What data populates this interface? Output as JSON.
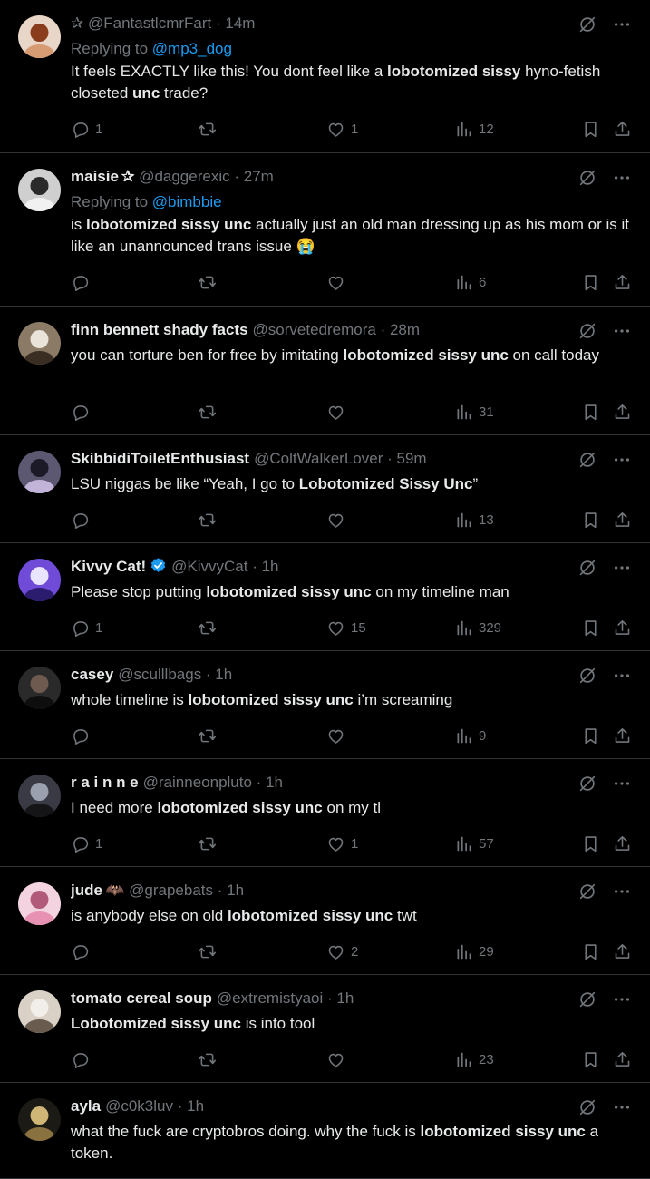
{
  "tweets": [
    {
      "prefix": "✰ ",
      "name": "",
      "handle": "@FantastlcmrFart",
      "time": "14m",
      "reply_to": "@mp3_dog",
      "body": [
        [
          "It feels EXACTLY like this! You dont feel like a ",
          ""
        ],
        [
          "lobotomized sissy",
          "b"
        ],
        [
          " hyno-fetish closeted ",
          ""
        ],
        [
          "unc",
          "b"
        ],
        [
          " trade?",
          ""
        ]
      ],
      "replies": "1",
      "retweets": "",
      "likes": "1",
      "views": "12"
    },
    {
      "prefix": "",
      "name": "maisie",
      "name_suffix": "✰",
      "handle": "@daggerexic",
      "time": "27m",
      "reply_to": "@bimbbie",
      "body": [
        [
          "is ",
          ""
        ],
        [
          "lobotomized sissy unc",
          "b"
        ],
        [
          " actually just an old man dressing up as his mom or is it like an unannounced trans issue ",
          ""
        ],
        [
          "😭",
          ""
        ]
      ],
      "replies": "",
      "retweets": "",
      "likes": "",
      "views": "6"
    },
    {
      "prefix": "",
      "name": "finn bennett shady facts",
      "handle": "@sorvetedremora",
      "time": "28m",
      "reply_to": "",
      "body": [
        [
          "you can torture ben for free by imitating ",
          ""
        ],
        [
          "lobotomized sissy unc",
          "b"
        ],
        [
          " on call today",
          ""
        ]
      ],
      "replies": "",
      "retweets": "",
      "likes": "",
      "views": "31"
    },
    {
      "prefix": "",
      "name": "SkibbidiToiletEnthusiast",
      "handle": "@ColtWalkerLover",
      "time": "59m",
      "reply_to": "",
      "body": [
        [
          "LSU niggas be like “Yeah, I go to ",
          ""
        ],
        [
          "Lobotomized Sissy Unc",
          "b"
        ],
        [
          "”",
          ""
        ]
      ],
      "replies": "",
      "retweets": "",
      "likes": "",
      "views": "13"
    },
    {
      "prefix": "",
      "name": "Kivvy Cat!",
      "verified": true,
      "handle": "@KivvyCat",
      "time": "1h",
      "reply_to": "",
      "body": [
        [
          "Please stop putting ",
          ""
        ],
        [
          "lobotomized sissy unc",
          "b"
        ],
        [
          " on my timeline man",
          ""
        ]
      ],
      "replies": "1",
      "retweets": "",
      "likes": "15",
      "views": "329"
    },
    {
      "prefix": "",
      "name": "casey",
      "handle": "@sculllbags",
      "time": "1h",
      "reply_to": "",
      "body": [
        [
          "whole timeline is ",
          ""
        ],
        [
          "lobotomized sissy unc",
          "b"
        ],
        [
          " i’m screaming",
          ""
        ]
      ],
      "replies": "",
      "retweets": "",
      "likes": "",
      "views": "9"
    },
    {
      "prefix": "",
      "name": "r a i n n e",
      "handle": "@rainneonpluto",
      "time": "1h",
      "reply_to": "",
      "body": [
        [
          "I need more ",
          ""
        ],
        [
          "lobotomized sissy unc",
          "b"
        ],
        [
          " on my tl",
          ""
        ]
      ],
      "replies": "1",
      "retweets": "",
      "likes": "1",
      "views": "57"
    },
    {
      "prefix": "",
      "name": "jude",
      "name_suffix": "🦇",
      "handle": "@grapebats",
      "time": "1h",
      "reply_to": "",
      "body": [
        [
          "is anybody else on old ",
          ""
        ],
        [
          "lobotomized sissy unc",
          "b"
        ],
        [
          " twt",
          ""
        ]
      ],
      "replies": "",
      "retweets": "",
      "likes": "2",
      "views": "29"
    },
    {
      "prefix": "",
      "name": "tomato cereal soup",
      "handle": "@extremistyaoi",
      "time": "1h",
      "reply_to": "",
      "body": [
        [
          "Lobotomized sissy unc",
          "b"
        ],
        [
          " is into tool",
          ""
        ]
      ],
      "replies": "",
      "retweets": "",
      "likes": "",
      "views": "23"
    },
    {
      "prefix": "",
      "name": "ayla",
      "handle": "@c0k3luv",
      "time": "1h",
      "reply_to": "",
      "body": [
        [
          "what the fuck are cryptobros doing. why the fuck is ",
          ""
        ],
        [
          "lobotomized sissy unc",
          "b"
        ],
        [
          " a token.",
          ""
        ]
      ],
      "replies": "",
      "retweets": "",
      "likes": "",
      "views": ""
    }
  ],
  "labels": {
    "replying_to": "Replying to ",
    "dot": " · "
  },
  "colors": {
    "background": "#000000",
    "text": "#e7e9ea",
    "muted": "#71767b",
    "link": "#1d9bf0",
    "divider": "#2f3336",
    "verified": "#1d9bf0"
  },
  "icons": [
    "reply-icon",
    "retweet-icon",
    "like-icon",
    "views-icon",
    "bookmark-icon",
    "share-icon",
    "grok-icon",
    "more-icon",
    "verified-badge-icon"
  ]
}
